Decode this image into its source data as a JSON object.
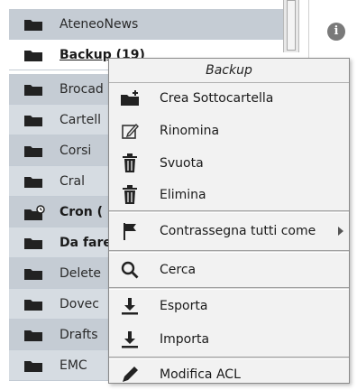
{
  "folders": [
    {
      "label": "AteneoNews",
      "bold": false,
      "underline": false,
      "badge": false
    },
    {
      "label": "Backup (19)",
      "bold": true,
      "underline": true,
      "badge": false
    },
    {
      "label": "Brocad",
      "bold": false,
      "underline": false,
      "badge": false
    },
    {
      "label": "Cartell",
      "bold": false,
      "underline": false,
      "badge": false
    },
    {
      "label": "Corsi",
      "bold": false,
      "underline": false,
      "badge": false
    },
    {
      "label": "Cral",
      "bold": false,
      "underline": false,
      "badge": false
    },
    {
      "label": "Cron (",
      "bold": true,
      "underline": false,
      "badge": true
    },
    {
      "label": "Da fare",
      "bold": true,
      "underline": false,
      "badge": false
    },
    {
      "label": "Delete",
      "bold": false,
      "underline": false,
      "badge": false
    },
    {
      "label": "Dovec",
      "bold": false,
      "underline": false,
      "badge": false
    },
    {
      "label": "Drafts",
      "bold": false,
      "underline": false,
      "badge": false
    },
    {
      "label": "EMC",
      "bold": false,
      "underline": false,
      "badge": false
    }
  ],
  "info_icon": {
    "glyph": "i"
  },
  "context_menu": {
    "title": "Backup",
    "items": {
      "create_subfolder": {
        "label": "Crea Sottocartella",
        "icon": "folder-add-icon"
      },
      "rename": {
        "label": "Rinomina",
        "icon": "edit-icon"
      },
      "empty": {
        "label": "Svuota",
        "icon": "trash-icon"
      },
      "delete": {
        "label": "Elimina",
        "icon": "trash-icon"
      },
      "mark_all": {
        "label": "Contrassegna tutti come",
        "icon": "flag-icon"
      },
      "search": {
        "label": "Cerca",
        "icon": "search-icon"
      },
      "export": {
        "label": "Esporta",
        "icon": "download-icon"
      },
      "import": {
        "label": "Importa",
        "icon": "download-icon"
      },
      "edit_acl": {
        "label": "Modifica ACL",
        "icon": "pencil-icon"
      }
    }
  },
  "colors": {
    "row_odd": "#c5ccd4",
    "row_even": "#d6dce2",
    "icon_dark": "#222222",
    "menu_bg": "#f2f2f2"
  }
}
